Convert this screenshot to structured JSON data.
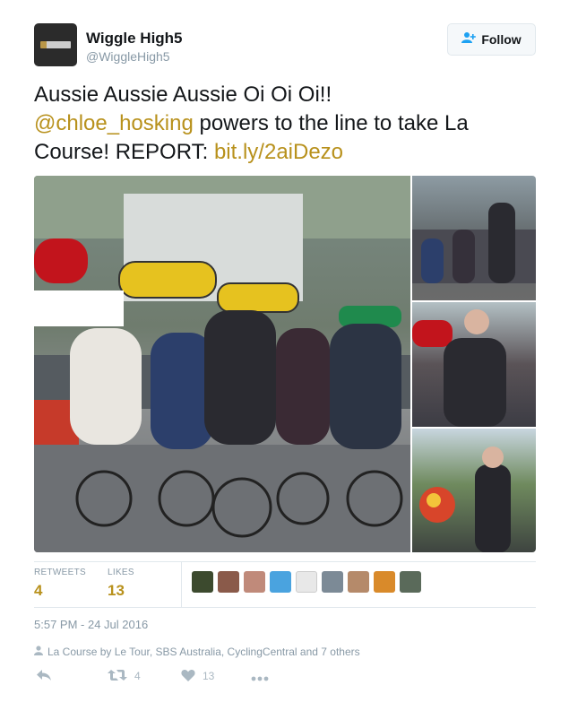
{
  "user": {
    "name": "Wiggle High5",
    "handle": "@WiggleHigh5",
    "follow_label": "Follow"
  },
  "tweet": {
    "text_line1": "Aussie Aussie Aussie Oi Oi Oi!!",
    "mention": "@chloe_hosking",
    "text_middle": " powers to the line to take La Course! REPORT: ",
    "link": "bit.ly/2aiDezo"
  },
  "stats": {
    "retweets_label": "RETWEETS",
    "retweets_value": "4",
    "likes_label": "LIKES",
    "likes_value": "13"
  },
  "timestamp": "5:57 PM - 24 Jul 2016",
  "context": "La Course by Le Tour, SBS Australia, CyclingCentral and 7 others",
  "actions": {
    "retweet_count": "4",
    "like_count": "13"
  },
  "colors": {
    "link": "#b8911c",
    "follow_icon": "#1da1f2",
    "meta": "#8899a6"
  },
  "icons": {
    "follow": "add-user-icon",
    "context": "person-icon",
    "reply": "reply-icon",
    "retweet": "retweet-icon",
    "like": "heart-icon",
    "more": "more-icon"
  }
}
